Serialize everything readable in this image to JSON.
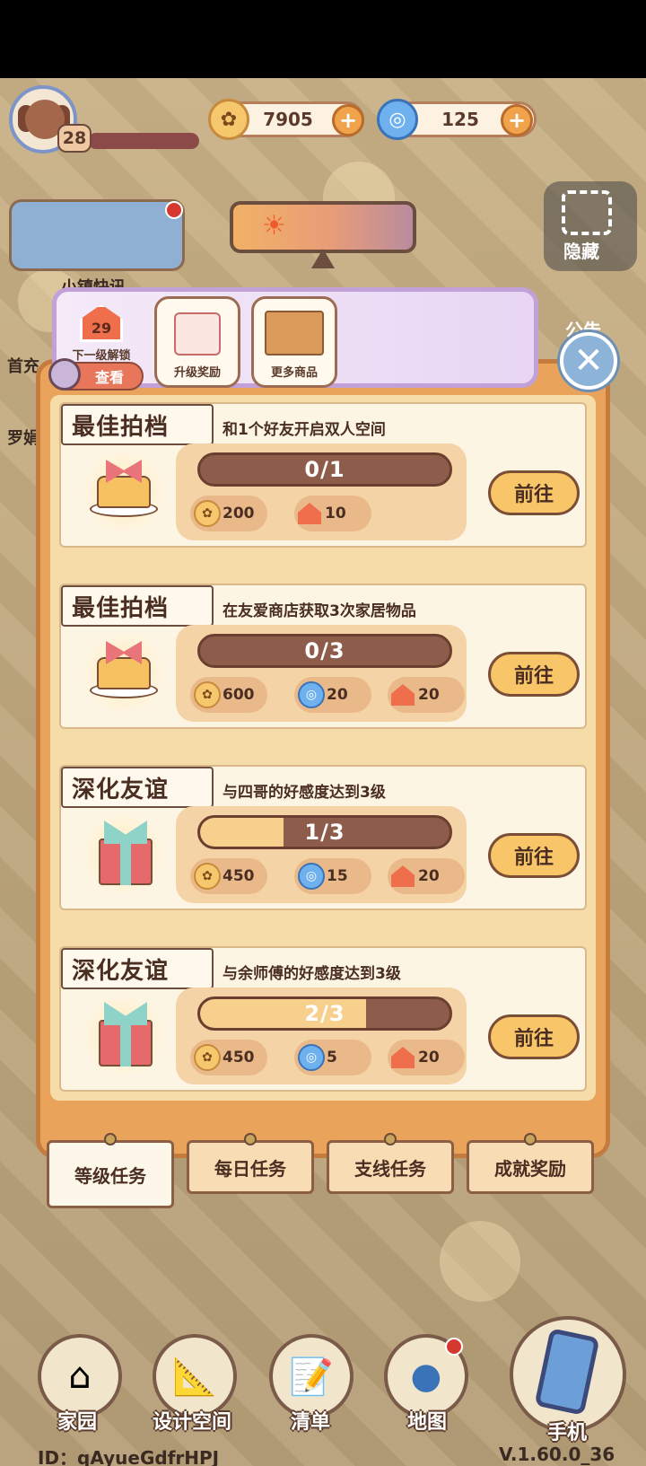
{
  "hud": {
    "player_level": "28",
    "coins": "7905",
    "gems": "125",
    "plus": "+"
  },
  "side": {
    "news_label": "小镇快讯",
    "first_charge_label": "首充",
    "character_label": "罗娟",
    "hide_label": "隐藏",
    "notice_label": "公告"
  },
  "top_tabs": {
    "next_level": "29",
    "next_level_label": "下一级解锁",
    "view_button": "查看",
    "upgrade_reward_label": "升级奖励",
    "more_goods_label": "更多商品"
  },
  "tasks": [
    {
      "title": "最佳拍档",
      "description": "和1个好友开启双人空间",
      "progress_text": "0/1",
      "progress_fraction": 0,
      "pic": "cake-icon",
      "rewards": [
        {
          "type": "coin-icon",
          "amount": "200"
        },
        {
          "type": "house-icon",
          "amount": "10"
        }
      ],
      "button": "前往"
    },
    {
      "title": "最佳拍档",
      "description": "在友爱商店获取3次家居物品",
      "progress_text": "0/3",
      "progress_fraction": 0,
      "pic": "cake-icon",
      "rewards": [
        {
          "type": "coin-icon",
          "amount": "600"
        },
        {
          "type": "gem-icon",
          "amount": "20"
        },
        {
          "type": "house-icon",
          "amount": "20"
        }
      ],
      "button": "前往"
    },
    {
      "title": "深化友谊",
      "description": "与四哥的好感度达到3级",
      "progress_text": "1/3",
      "progress_fraction": 0.333,
      "pic": "gift-icon",
      "rewards": [
        {
          "type": "coin-icon",
          "amount": "450"
        },
        {
          "type": "gem-icon",
          "amount": "15"
        },
        {
          "type": "house-icon",
          "amount": "20"
        }
      ],
      "button": "前往"
    },
    {
      "title": "深化友谊",
      "description": "与余师傅的好感度达到3级",
      "progress_text": "2/3",
      "progress_fraction": 0.667,
      "pic": "gift-icon",
      "rewards": [
        {
          "type": "coin-icon",
          "amount": "450"
        },
        {
          "type": "gem-icon",
          "amount": "5"
        },
        {
          "type": "house-icon",
          "amount": "20"
        }
      ],
      "button": "前往"
    }
  ],
  "bottom_tabs": [
    "等级任务",
    "每日任务",
    "支线任务",
    "成就奖励"
  ],
  "nav": {
    "home": "家园",
    "design": "设计空间",
    "list": "清单",
    "map": "地图",
    "phone": "手机"
  },
  "footer": {
    "id": "ID：qAyueGdfrHPJ",
    "version": "V.1.60.0_36"
  },
  "colors": {
    "panel": "#e9a35b",
    "card": "#fdf5e4",
    "button": "#f8c668",
    "progress_track": "#8d5c4a",
    "progress_fill": "#f7d08d"
  }
}
